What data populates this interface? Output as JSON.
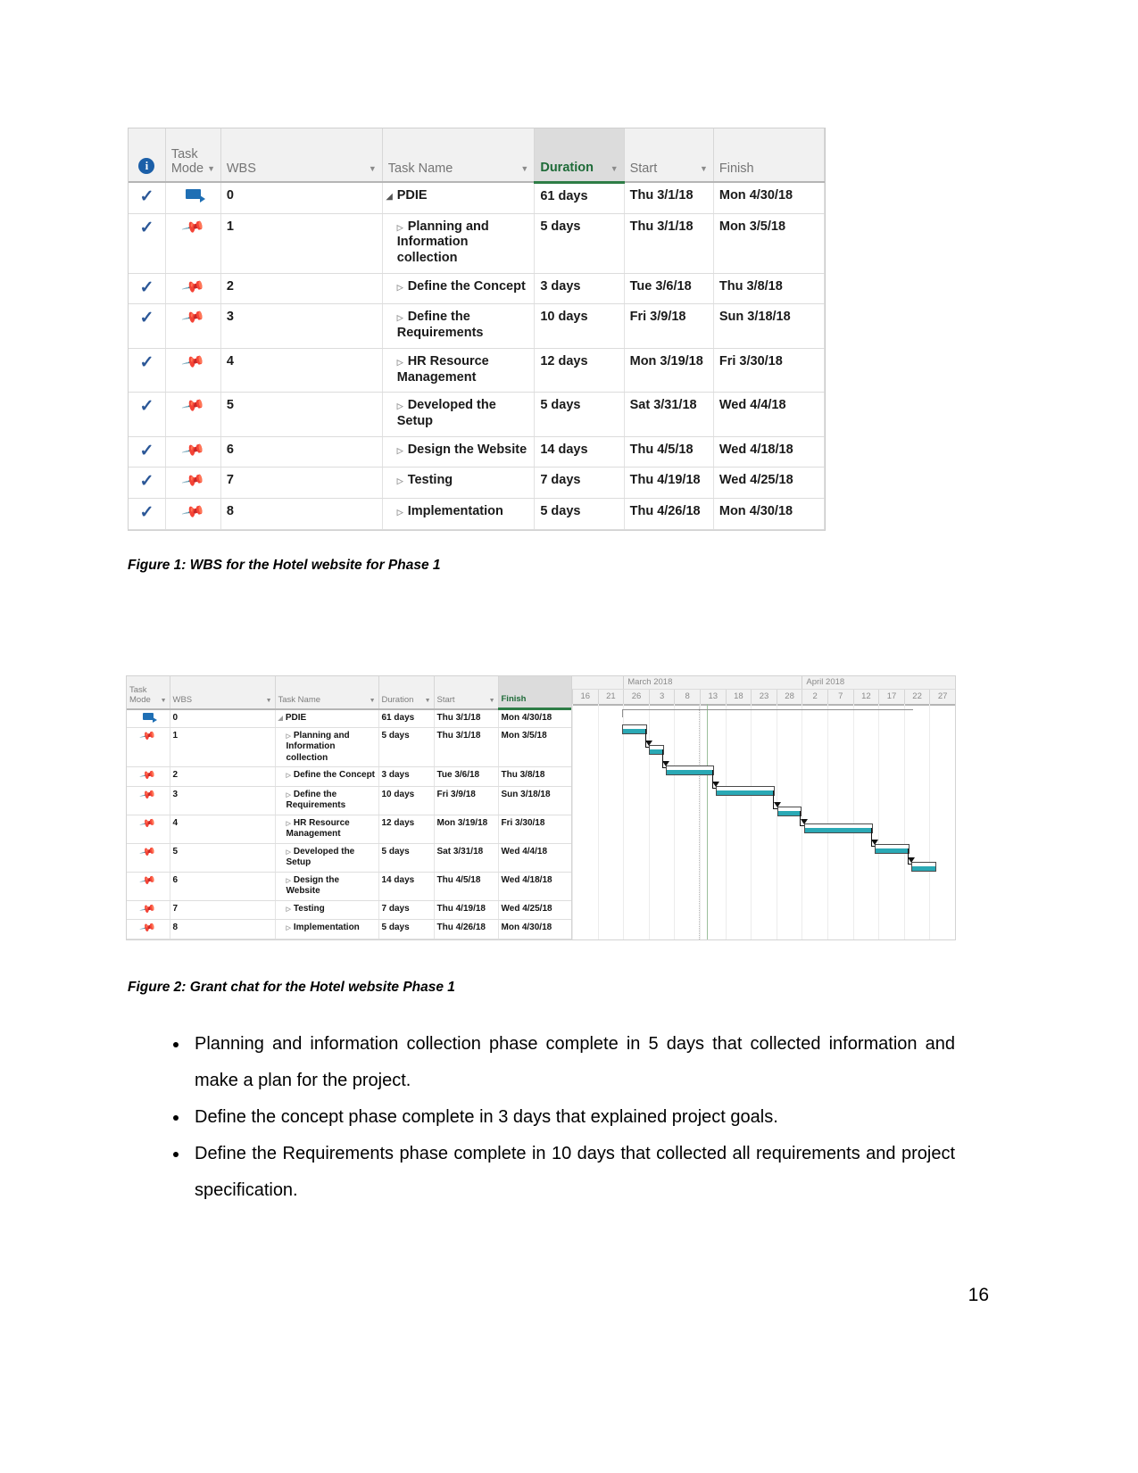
{
  "figure1": {
    "columns": [
      "",
      "Task Mode",
      "WBS",
      "Task Name",
      "Duration",
      "Start",
      "Finish"
    ],
    "headers": {
      "info": "info-icon",
      "task_mode_line1": "Task",
      "task_mode_line2": "Mode",
      "wbs": "WBS",
      "task_name": "Task Name",
      "duration": "Duration",
      "start": "Start",
      "finish": "Finish"
    },
    "rows": [
      {
        "indicator": "check",
        "mode": "auto",
        "wbs": "0",
        "name": "PDIE",
        "duration": "61 days",
        "start": "Thu 3/1/18",
        "finish": "Mon 4/30/18",
        "summary": true
      },
      {
        "indicator": "check",
        "mode": "pin",
        "wbs": "1",
        "name": "Planning and Information collection",
        "duration": "5 days",
        "start": "Thu 3/1/18",
        "finish": "Mon 3/5/18",
        "summary": false
      },
      {
        "indicator": "check",
        "mode": "pin",
        "wbs": "2",
        "name": "Define the Concept",
        "duration": "3 days",
        "start": "Tue 3/6/18",
        "finish": "Thu 3/8/18",
        "summary": false
      },
      {
        "indicator": "check",
        "mode": "pin",
        "wbs": "3",
        "name": "Define the Requirements",
        "duration": "10 days",
        "start": "Fri 3/9/18",
        "finish": "Sun 3/18/18",
        "summary": false
      },
      {
        "indicator": "check",
        "mode": "pin",
        "wbs": "4",
        "name": "HR Resource Management",
        "duration": "12 days",
        "start": "Mon 3/19/18",
        "finish": "Fri 3/30/18",
        "summary": false
      },
      {
        "indicator": "check",
        "mode": "pin",
        "wbs": "5",
        "name": "Developed the Setup",
        "duration": "5 days",
        "start": "Sat 3/31/18",
        "finish": "Wed 4/4/18",
        "summary": false
      },
      {
        "indicator": "check",
        "mode": "pin",
        "wbs": "6",
        "name": "Design the Website",
        "duration": "14 days",
        "start": "Thu 4/5/18",
        "finish": "Wed 4/18/18",
        "summary": false
      },
      {
        "indicator": "check",
        "mode": "pin",
        "wbs": "7",
        "name": "Testing",
        "duration": "7 days",
        "start": "Thu 4/19/18",
        "finish": "Wed 4/25/18",
        "summary": false
      },
      {
        "indicator": "check",
        "mode": "pin",
        "wbs": "8",
        "name": "Implementation",
        "duration": "5 days",
        "start": "Thu 4/26/18",
        "finish": "Mon 4/30/18",
        "summary": false
      }
    ],
    "caption": "Figure 1: WBS for the Hotel website for Phase 1"
  },
  "figure2": {
    "headers": {
      "task_mode_line1": "Task",
      "task_mode_line2": "Mode",
      "wbs": "WBS",
      "task_name": "Task Name",
      "duration": "Duration",
      "start": "Start",
      "finish": "Finish"
    },
    "rows": [
      {
        "mode": "auto",
        "wbs": "0",
        "name": "PDIE",
        "duration": "61 days",
        "start": "Thu 3/1/18",
        "finish": "Mon 4/30/18",
        "summary": true
      },
      {
        "mode": "pin",
        "wbs": "1",
        "name": "Planning and Information collection",
        "duration": "5 days",
        "start": "Thu 3/1/18",
        "finish": "Mon 3/5/18",
        "summary": false
      },
      {
        "mode": "pin",
        "wbs": "2",
        "name": "Define the Concept",
        "duration": "3 days",
        "start": "Tue 3/6/18",
        "finish": "Thu 3/8/18",
        "summary": false
      },
      {
        "mode": "pin",
        "wbs": "3",
        "name": "Define the Requirements",
        "duration": "10 days",
        "start": "Fri 3/9/18",
        "finish": "Sun 3/18/18",
        "summary": false
      },
      {
        "mode": "pin",
        "wbs": "4",
        "name": "HR Resource Management",
        "duration": "12 days",
        "start": "Mon 3/19/18",
        "finish": "Fri 3/30/18",
        "summary": false
      },
      {
        "mode": "pin",
        "wbs": "5",
        "name": "Developed the Setup",
        "duration": "5 days",
        "start": "Sat 3/31/18",
        "finish": "Wed 4/4/18",
        "summary": false
      },
      {
        "mode": "pin",
        "wbs": "6",
        "name": "Design the Website",
        "duration": "14 days",
        "start": "Thu 4/5/18",
        "finish": "Wed 4/18/18",
        "summary": false
      },
      {
        "mode": "pin",
        "wbs": "7",
        "name": "Testing",
        "duration": "7 days",
        "start": "Thu 4/19/18",
        "finish": "Wed 4/25/18",
        "summary": false
      },
      {
        "mode": "pin",
        "wbs": "8",
        "name": "Implementation",
        "duration": "5 days",
        "start": "Thu 4/26/18",
        "finish": "Mon 4/30/18",
        "summary": false
      }
    ],
    "caption": "Figure 2: Grant chat for the Hotel website Phase 1",
    "timeline": {
      "months": [
        "March 2018",
        "April 2018"
      ],
      "day_ticks": [
        "16",
        "21",
        "26",
        "3",
        "8",
        "13",
        "18",
        "23",
        "28",
        "2",
        "7",
        "12",
        "17",
        "22",
        "27"
      ],
      "bar_color": "#2aa9b5",
      "bars": [
        {
          "task": "PDIE",
          "type": "summary",
          "start_pct": 13.0,
          "width_pct": 76.0,
          "row": 0
        },
        {
          "task": "Planning and Information collection",
          "type": "task",
          "start_pct": 13.0,
          "width_pct": 6.5,
          "row": 1
        },
        {
          "task": "Define the Concept",
          "type": "task",
          "start_pct": 20.0,
          "width_pct": 4.0,
          "row": 2
        },
        {
          "task": "Define the Requirements",
          "type": "task",
          "start_pct": 24.5,
          "width_pct": 12.5,
          "row": 3
        },
        {
          "task": "HR Resource Management",
          "type": "task",
          "start_pct": 37.5,
          "width_pct": 15.5,
          "row": 4
        },
        {
          "task": "Developed the Setup",
          "type": "task",
          "start_pct": 53.5,
          "width_pct": 6.5,
          "row": 5
        },
        {
          "task": "Design the Website",
          "type": "task",
          "start_pct": 60.5,
          "width_pct": 18.0,
          "row": 6
        },
        {
          "task": "Testing",
          "type": "task",
          "start_pct": 79.0,
          "width_pct": 9.0,
          "row": 7
        },
        {
          "task": "Implementation",
          "type": "task",
          "start_pct": 88.5,
          "width_pct": 6.5,
          "row": 8
        }
      ]
    }
  },
  "bullets": [
    "Planning and information collection phase complete in 5 days that collected information and make a plan for the project.",
    "Define the concept phase complete in 3 days that explained project goals.",
    "Define the Requirements phase complete in 10 days that collected all requirements and project specification."
  ],
  "page_number": "16"
}
